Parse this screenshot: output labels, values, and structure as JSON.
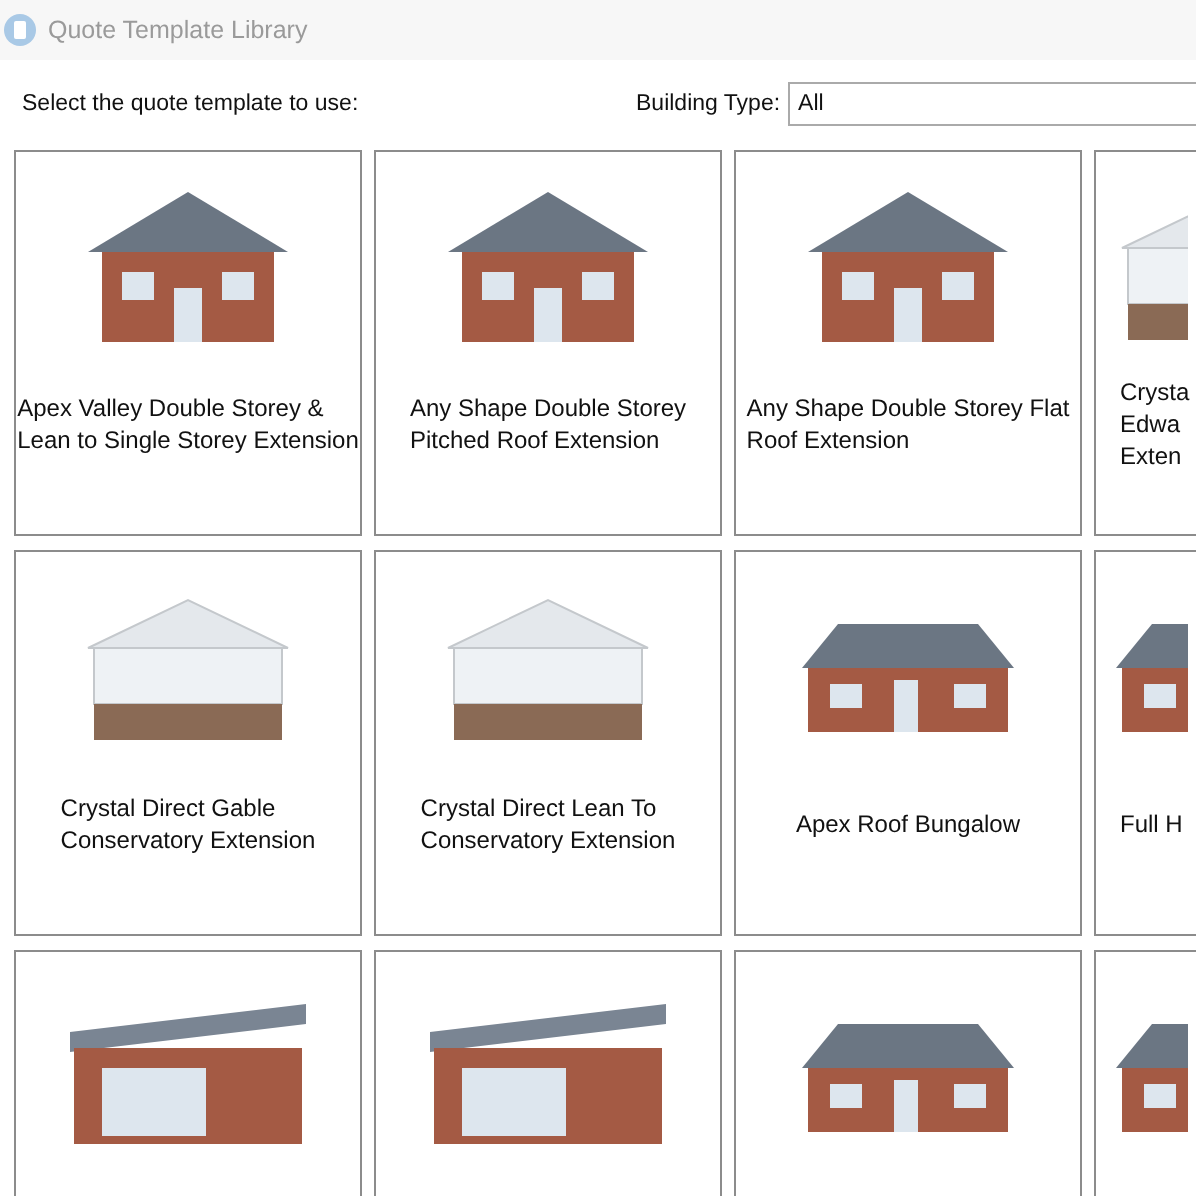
{
  "window": {
    "title": "Quote Template Library"
  },
  "prompt": "Select the quote template to use:",
  "filter": {
    "label": "Building Type:",
    "value": "All"
  },
  "templates": [
    {
      "kind": "house",
      "lines": [
        "Apex Valley Double Storey &",
        "Lean to Single Storey Extension"
      ]
    },
    {
      "kind": "house",
      "lines": [
        "Any Shape Double Storey",
        "Pitched Roof Extension"
      ]
    },
    {
      "kind": "house",
      "lines": [
        "Any Shape Double Storey Flat",
        "Roof Extension"
      ]
    },
    {
      "kind": "conservatory",
      "lines": [
        "Crysta",
        "Edwa",
        "Exten"
      ]
    },
    {
      "kind": "conservatory",
      "lines": [
        "Crystal Direct Gable",
        "Conservatory Extension"
      ]
    },
    {
      "kind": "conservatory",
      "lines": [
        "Crystal Direct Lean To",
        "Conservatory Extension"
      ]
    },
    {
      "kind": "bungalow",
      "lines": [
        "Apex Roof Bungalow"
      ]
    },
    {
      "kind": "bungalow",
      "lines": [
        "Full H"
      ]
    },
    {
      "kind": "extension"
    },
    {
      "kind": "extension"
    },
    {
      "kind": "bungalow"
    },
    {
      "kind": "bungalow"
    }
  ]
}
